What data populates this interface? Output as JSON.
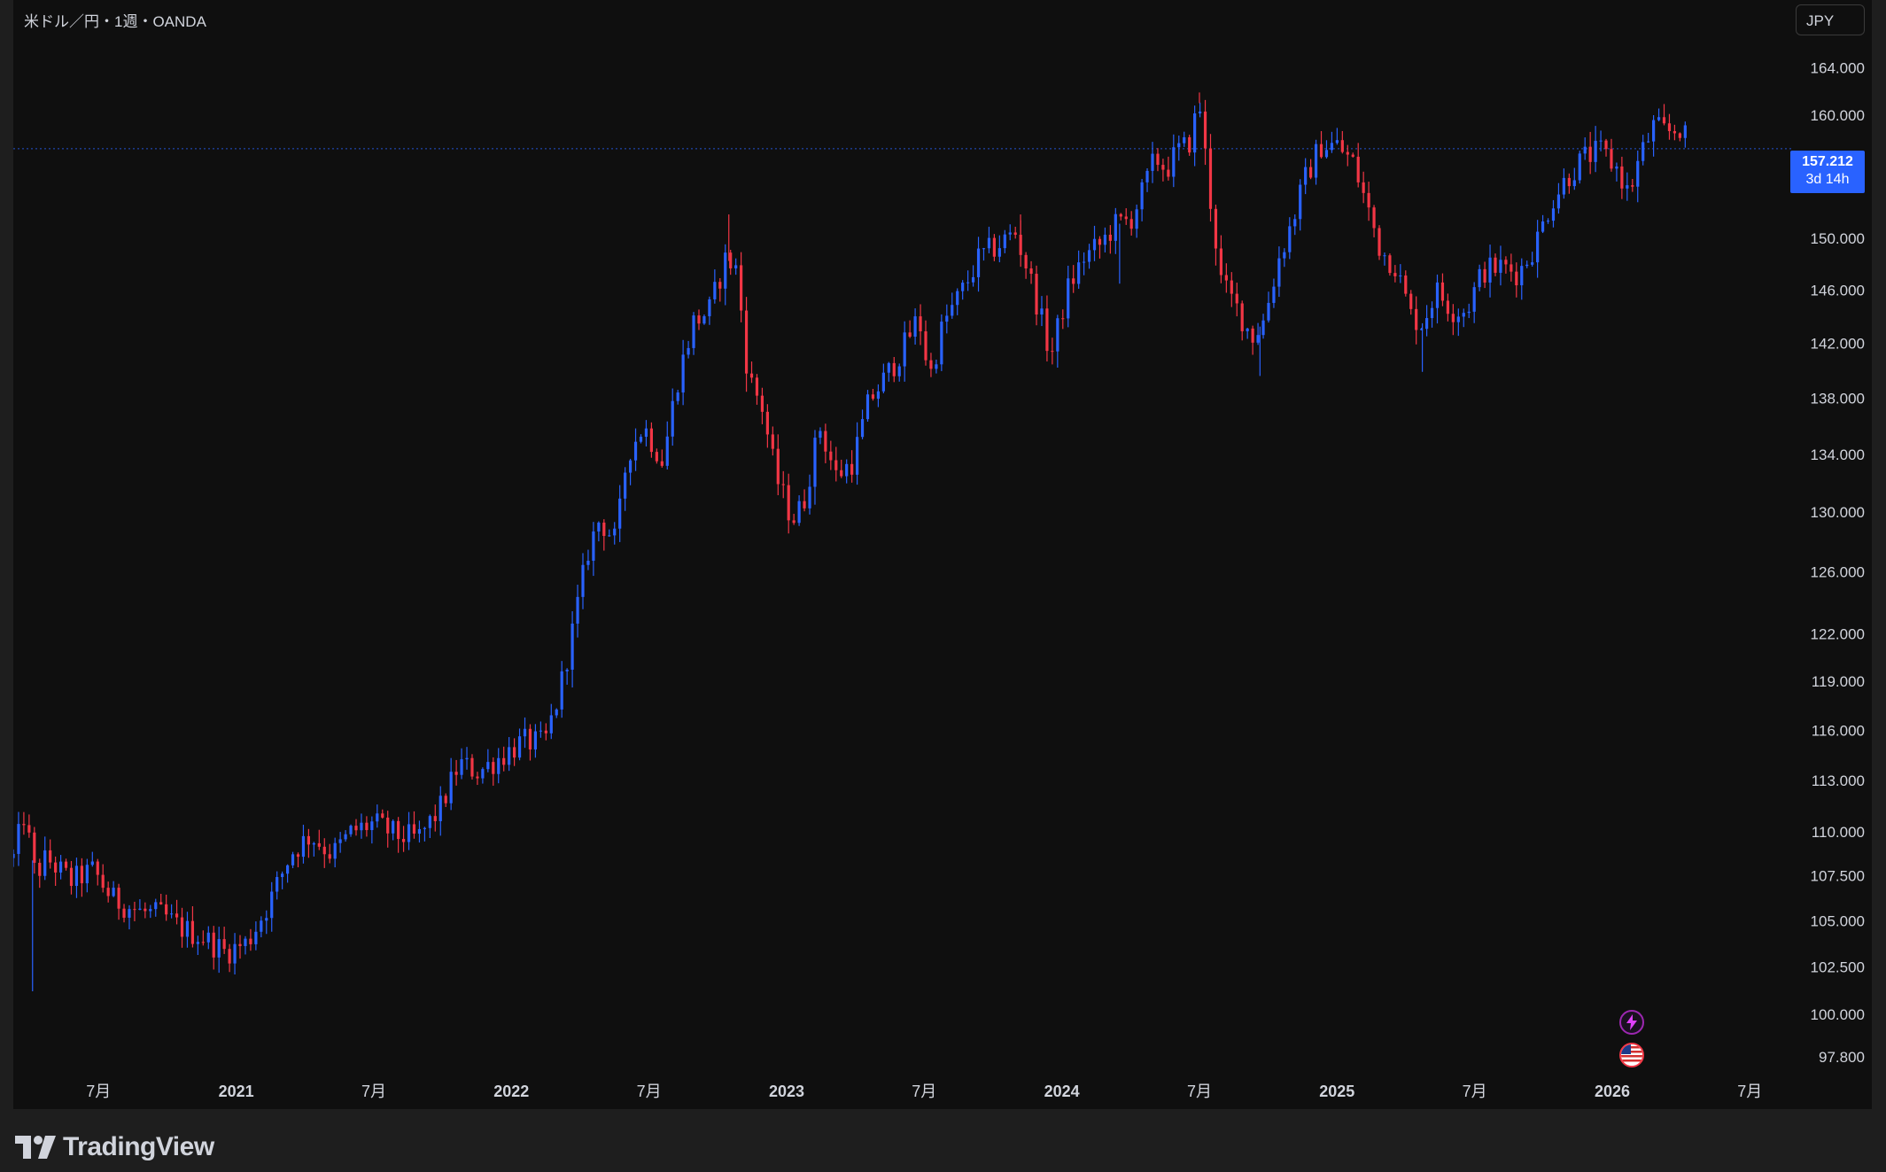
{
  "header": {
    "symbol_title": "米ドル／円・1週・OANDA",
    "currency": "JPY"
  },
  "price_tag": {
    "price": "157.212",
    "countdown": "3d 14h",
    "value": 157.212
  },
  "footer": {
    "brand": "TradingView"
  },
  "icons": [
    "flash-icon",
    "us-flag-icon",
    "tradingview-logo-icon"
  ],
  "colors": {
    "up": "#2962ff",
    "down": "#f23645",
    "background": "#0f0f0f",
    "text": "#d1d4dc",
    "price_line": "#2962ff"
  },
  "chart_data": {
    "type": "candlestick",
    "title": "米ドル／円・1週・OANDA",
    "ylim": [
      96.8,
      166.8
    ],
    "yscale": "log",
    "y_ticks": [
      {
        "label": "164.000",
        "value": 164
      },
      {
        "label": "160.000",
        "value": 160
      },
      {
        "label": "150.000",
        "value": 150
      },
      {
        "label": "146.000",
        "value": 146
      },
      {
        "label": "142.000",
        "value": 142
      },
      {
        "label": "138.000",
        "value": 138
      },
      {
        "label": "134.000",
        "value": 134
      },
      {
        "label": "130.000",
        "value": 130
      },
      {
        "label": "126.000",
        "value": 126
      },
      {
        "label": "122.000",
        "value": 122
      },
      {
        "label": "119.000",
        "value": 119
      },
      {
        "label": "116.000",
        "value": 116
      },
      {
        "label": "113.000",
        "value": 113
      },
      {
        "label": "110.000",
        "value": 110
      },
      {
        "label": "107.500",
        "value": 107.5
      },
      {
        "label": "105.000",
        "value": 105
      },
      {
        "label": "102.500",
        "value": 102.5
      },
      {
        "label": "100.000",
        "value": 100
      },
      {
        "label": "97.800",
        "value": 97.8
      }
    ],
    "x_range": [
      2020.19,
      2026.66
    ],
    "x_ticks": [
      {
        "label": "7月",
        "value": 2020.5,
        "bold": false
      },
      {
        "label": "2021",
        "value": 2021.0,
        "bold": true
      },
      {
        "label": "7月",
        "value": 2021.5,
        "bold": false
      },
      {
        "label": "2022",
        "value": 2022.0,
        "bold": true
      },
      {
        "label": "7月",
        "value": 2022.5,
        "bold": false
      },
      {
        "label": "2023",
        "value": 2023.0,
        "bold": true
      },
      {
        "label": "7月",
        "value": 2023.5,
        "bold": false
      },
      {
        "label": "2024",
        "value": 2024.0,
        "bold": true
      },
      {
        "label": "7月",
        "value": 2024.5,
        "bold": false
      },
      {
        "label": "2025",
        "value": 2025.0,
        "bold": true
      },
      {
        "label": "7月",
        "value": 2025.5,
        "bold": false
      },
      {
        "label": "2026",
        "value": 2026.0,
        "bold": true
      },
      {
        "label": "7月",
        "value": 2026.5,
        "bold": false
      }
    ],
    "last_price": 157.212,
    "last_time": 2026.28,
    "close_path": [
      [
        2020.19,
        108.5
      ],
      [
        2020.23,
        111.0
      ],
      [
        2020.27,
        107.5
      ],
      [
        2020.31,
        108.5
      ],
      [
        2020.4,
        107.2
      ],
      [
        2020.48,
        107.8
      ],
      [
        2020.55,
        106.2
      ],
      [
        2020.65,
        105.5
      ],
      [
        2020.73,
        105.3
      ],
      [
        2020.8,
        104.6
      ],
      [
        2020.88,
        104.1
      ],
      [
        2020.96,
        103.3
      ],
      [
        2021.04,
        103.8
      ],
      [
        2021.12,
        106.0
      ],
      [
        2021.2,
        108.8
      ],
      [
        2021.27,
        109.8
      ],
      [
        2021.35,
        108.7
      ],
      [
        2021.42,
        110.0
      ],
      [
        2021.5,
        110.5
      ],
      [
        2021.58,
        109.8
      ],
      [
        2021.66,
        109.6
      ],
      [
        2021.74,
        111.3
      ],
      [
        2021.81,
        114.0
      ],
      [
        2021.88,
        113.5
      ],
      [
        2021.96,
        114.4
      ],
      [
        2022.04,
        115.3
      ],
      [
        2022.12,
        115.2
      ],
      [
        2022.17,
        118.0
      ],
      [
        2022.22,
        122.0
      ],
      [
        2022.28,
        127.5
      ],
      [
        2022.32,
        129.5
      ],
      [
        2022.38,
        128.0
      ],
      [
        2022.42,
        134.0
      ],
      [
        2022.48,
        136.0
      ],
      [
        2022.55,
        133.5
      ],
      [
        2022.6,
        139.0
      ],
      [
        2022.66,
        143.5
      ],
      [
        2022.72,
        144.5
      ],
      [
        2022.78,
        148.5
      ],
      [
        2022.82,
        147.5
      ],
      [
        2022.86,
        139.5
      ],
      [
        2022.91,
        137.5
      ],
      [
        2022.96,
        132.5
      ],
      [
        2023.02,
        129.5
      ],
      [
        2023.06,
        130.5
      ],
      [
        2023.12,
        136.0
      ],
      [
        2023.18,
        132.5
      ],
      [
        2023.24,
        133.5
      ],
      [
        2023.3,
        137.8
      ],
      [
        2023.36,
        139.5
      ],
      [
        2023.42,
        141.5
      ],
      [
        2023.48,
        144.0
      ],
      [
        2023.52,
        139.5
      ],
      [
        2023.57,
        143.5
      ],
      [
        2023.64,
        146.0
      ],
      [
        2023.7,
        148.5
      ],
      [
        2023.77,
        149.5
      ],
      [
        2023.83,
        150.5
      ],
      [
        2023.87,
        148.0
      ],
      [
        2023.91,
        145.0
      ],
      [
        2023.96,
        141.0
      ],
      [
        2024.02,
        146.0
      ],
      [
        2024.08,
        148.5
      ],
      [
        2024.14,
        149.5
      ],
      [
        2024.19,
        151.0
      ],
      [
        2024.25,
        151.5
      ],
      [
        2024.3,
        154.0
      ],
      [
        2024.34,
        156.5
      ],
      [
        2024.38,
        155.5
      ],
      [
        2024.42,
        157.0
      ],
      [
        2024.46,
        157.5
      ],
      [
        2024.5,
        161.0
      ],
      [
        2024.54,
        153.0
      ],
      [
        2024.58,
        146.5
      ],
      [
        2024.64,
        144.5
      ],
      [
        2024.69,
        142.5
      ],
      [
        2024.73,
        143.5
      ],
      [
        2024.79,
        148.5
      ],
      [
        2024.84,
        151.5
      ],
      [
        2024.88,
        154.5
      ],
      [
        2024.94,
        157.5
      ],
      [
        2025.0,
        157.5
      ],
      [
        2025.06,
        156.0
      ],
      [
        2025.11,
        152.5
      ],
      [
        2025.16,
        149.0
      ],
      [
        2025.21,
        148.0
      ],
      [
        2025.27,
        144.0
      ],
      [
        2025.31,
        143.5
      ],
      [
        2025.36,
        146.0
      ],
      [
        2025.42,
        144.5
      ],
      [
        2025.47,
        144.5
      ],
      [
        2025.53,
        147.5
      ],
      [
        2025.6,
        147.8
      ],
      [
        2025.66,
        147.3
      ],
      [
        2025.72,
        149.5
      ],
      [
        2025.78,
        153.0
      ],
      [
        2025.84,
        155.0
      ],
      [
        2025.9,
        156.5
      ],
      [
        2025.96,
        157.0
      ],
      [
        2026.02,
        155.5
      ],
      [
        2026.06,
        153.5
      ],
      [
        2026.1,
        156.5
      ],
      [
        2026.15,
        159.0
      ],
      [
        2026.2,
        158.5
      ],
      [
        2026.25,
        159.0
      ],
      [
        2026.28,
        157.212
      ]
    ],
    "spikes": [
      {
        "time": 2020.26,
        "low": 101.2
      },
      {
        "time": 2022.79,
        "high": 151.9
      },
      {
        "time": 2024.21,
        "low": 146.5
      },
      {
        "time": 2024.5,
        "high": 161.9
      },
      {
        "time": 2024.72,
        "low": 139.6
      },
      {
        "time": 2025.31,
        "low": 139.9
      },
      {
        "time": 2023.85,
        "high": 151.9
      }
    ]
  }
}
